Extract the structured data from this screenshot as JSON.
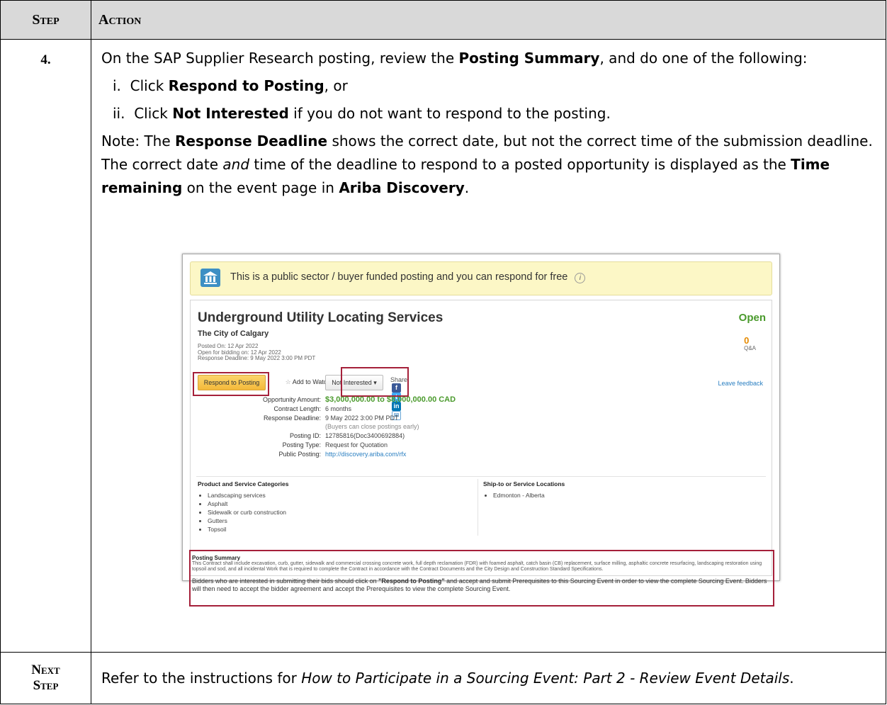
{
  "header": {
    "step": "Step",
    "action": "Action"
  },
  "step4": {
    "number": "4.",
    "intro_pre": "On the SAP Supplier Research posting, review the ",
    "intro_bold": "Posting Summary",
    "intro_post": ", and do one of the following:",
    "opt1_num": "i.",
    "opt1_pre": "Click ",
    "opt1_bold": "Respond to Posting",
    "opt1_post": ", or",
    "opt2_num": "ii.",
    "opt2_pre": "Click ",
    "opt2_bold": "Not Interested",
    "opt2_post": " if you do not want to respond to the posting.",
    "note_pre": "Note: The ",
    "note_b1": "Response Deadline",
    "note_mid1": " shows the correct date, but not the correct time of the submission deadline. The correct date ",
    "note_i": "and",
    "note_mid2": " time of the deadline to respond to a posted opportunity is displayed as the ",
    "note_b2": "Time remaining",
    "note_mid3": " on the event page in ",
    "note_b3": "Ariba Discovery",
    "note_end": "."
  },
  "screenshot": {
    "banner": "This is a public sector / buyer funded posting and you can respond for free",
    "title": "Underground Utility Locating Services",
    "org": "The City of Calgary",
    "posted_on": "Posted On:  12 Apr 2022",
    "open_bidding": "Open for bidding on:  12 Apr 2022",
    "response_deadline_meta": "Response Deadline:  9 May 2022 3:00 PM PDT",
    "status": "Open",
    "qa_count": "0",
    "qa_label": "Q&A",
    "btn_respond": "Respond to Posting",
    "btn_watchlist": "Add to Watchlist",
    "btn_not_interested": "Not Interested",
    "share": "Share:",
    "leave_feedback": "Leave feedback",
    "details": {
      "l1": "Opportunity Amount:",
      "v1": "$3,000,000.00 to $8,000,000.00 CAD",
      "l2": "Contract Length:",
      "v2": "6 months",
      "l3": "Response Deadline:",
      "v3": "9 May 2022 3:00 PM PDT",
      "v3b": "(Buyers can close postings early)",
      "l4": "Posting ID:",
      "v4": "12785816(Doc3400692884)",
      "l5": "Posting Type:",
      "v5": "Request for Quotation",
      "l6": "Public Posting:",
      "v6": "http://discovery.ariba.com/rfx"
    },
    "categories_title": "Product and Service Categories",
    "categories": [
      "Landscaping services",
      "Asphalt",
      "Sidewalk or curb construction",
      "Gutters",
      "Topsoil"
    ],
    "locations_title": "Ship-to or Service Locations",
    "locations": [
      "Edmonton - Alberta"
    ],
    "summary_title": "Posting Summary",
    "summary_text": "This Contract shall include excavation, curb, gutter, sidewalk and commercial crossing concrete work, full depth reclamation (FDR) with foamed asphalt, catch basin (CB) replacement, surface milling, asphaltic concrete resurfacing, landscaping restoration using topsoil and sod, and all incidental Work that is required to complete the Contract in accordance with the Contract Documents and the City Design and Construction Standard Specifications.",
    "summary_pre": "Bidders who are interested in submitting their bids should click on ",
    "summary_bold": "\"Respond to Posting\"",
    "summary_post": " and accept and submit Prerequisites to this Sourcing Event in order to view the complete Sourcing Event. Bidders will then need to accept the bidder agreement and accept the Prerequisites to view the complete Sourcing Event."
  },
  "next": {
    "label_1": "Next",
    "label_2": "Step",
    "pre": "Refer to the instructions for ",
    "italic": "How to Participate in a Sourcing Event: Part 2 - Review Event Details",
    "post": "."
  },
  "colors": {
    "highlight_red": "#a5203a",
    "banner_bg": "#fcf7c6",
    "open_green": "#4a9a2c"
  }
}
